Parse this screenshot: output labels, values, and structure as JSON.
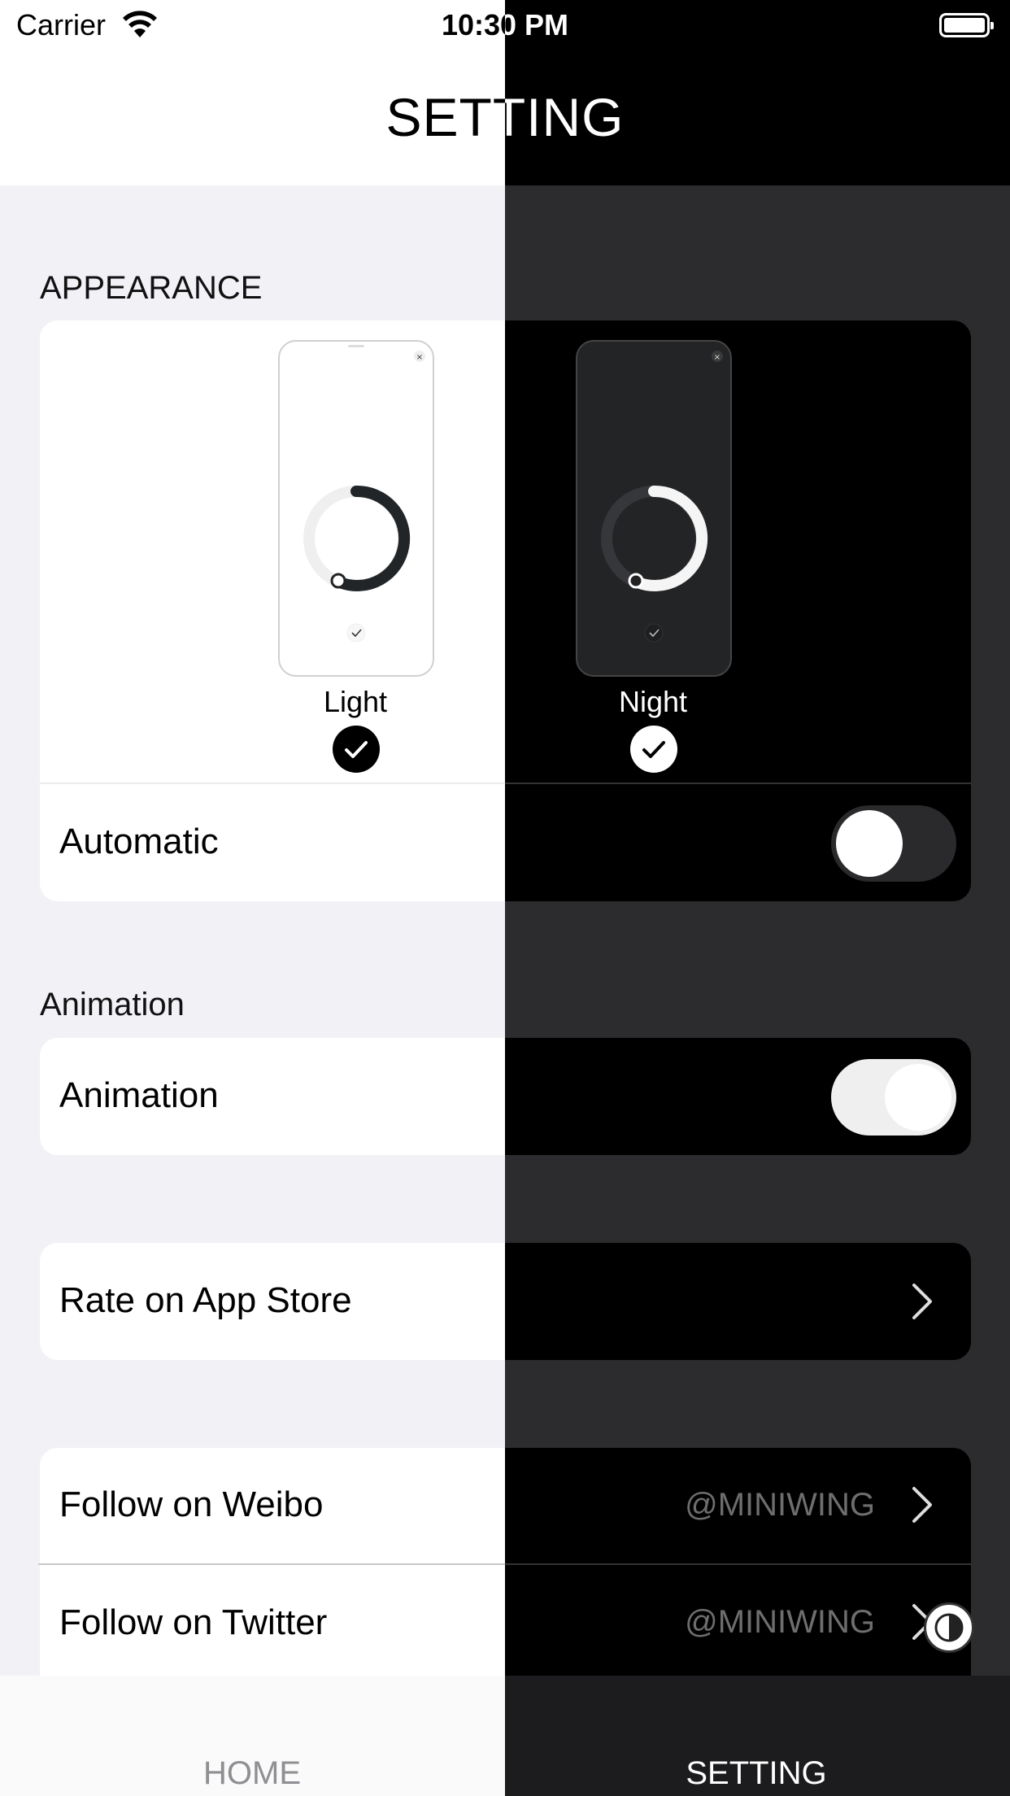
{
  "status": {
    "carrier": "Carrier",
    "time": "10:30 PM"
  },
  "nav": {
    "title": "SETTING"
  },
  "appearance": {
    "header": "APPEARANCE",
    "light_label": "Light",
    "night_label": "Night",
    "automatic_label": "Automatic",
    "automatic_on": false
  },
  "animation": {
    "header": "Animation",
    "label": "Animation",
    "on": true
  },
  "rate": {
    "label": "Rate on App Store"
  },
  "follow": {
    "weibo_label": "Follow on Weibo",
    "weibo_handle": "@MINIWING",
    "twitter_label": "Follow on Twitter",
    "twitter_handle": "@MINIWING"
  },
  "tabs": {
    "home": "HOME",
    "setting": "SETTING"
  },
  "colors": {
    "light_bg": "#f2f1f6",
    "dark_bg": "#2c2c2e",
    "toggle_on": "#f0f0f0",
    "toggle_off": "#2a2a2c"
  }
}
